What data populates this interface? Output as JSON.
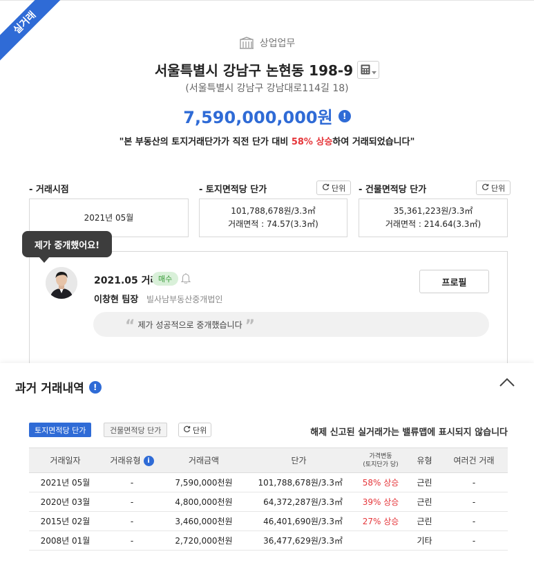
{
  "corner_badge": "실거래",
  "header": {
    "category": "상업업무",
    "address": "서울특별시 강남구 논현동 198-9",
    "road_address": "(서울특별시 강남구 강남대로114길 18)",
    "price": "7,590,000,000원"
  },
  "notice": {
    "prefix": "\"본 부동산의 토지거래단가가 직전 단가 대비",
    "highlight": "58% 상승",
    "suffix": "하여 거래되었습니다\""
  },
  "summary": {
    "date_label": "- 거래시점",
    "date_value": "2021년 05월",
    "land_label": "- 토지면적당 단가",
    "land_price": "101,788,678원/3.3㎡",
    "land_area": "거래면적 : 74.57(3.3㎡)",
    "bldg_label": "- 건물면적당 단가",
    "bldg_price": "35,361,223원/3.3㎡",
    "bldg_area": "거래면적 : 214.64(3.3㎡)",
    "unit_label": "단위"
  },
  "agent": {
    "tooltip": "제가 중개했어요!",
    "deal": "2021.05 거래",
    "badge": "매수",
    "name": "이창현 팀장",
    "agency": "빌사남부동산중개법인",
    "profile_button": "프로필",
    "comment": "제가 성공적으로 중개했습니다"
  },
  "history": {
    "title": "과거 거래내역",
    "tab_land": "토지면적당 단가",
    "tab_bldg": "건물면적당 단가",
    "unit_label": "단위",
    "hint": "해제 신고된 실거래가는 밸류맵에 표시되지 않습니다",
    "columns": {
      "date": "거래일자",
      "type": "거래유형",
      "amount": "거래금액",
      "unit_price": "단가",
      "change1": "가격변동",
      "change2": "(토지단가 당)",
      "kind": "유형",
      "multi": "여러건 거래"
    },
    "rows": [
      {
        "date": "2021년 05월",
        "type": "-",
        "amount": "7,590,000천원",
        "unit_price": "101,788,678원/3.3㎡",
        "change": "58% 상승",
        "kind": "근린",
        "multi": "-"
      },
      {
        "date": "2020년 03월",
        "type": "-",
        "amount": "4,800,000천원",
        "unit_price": "64,372,287원/3.3㎡",
        "change": "39% 상승",
        "kind": "근린",
        "multi": "-"
      },
      {
        "date": "2015년 02월",
        "type": "-",
        "amount": "3,460,000천원",
        "unit_price": "46,401,690원/3.3㎡",
        "change": "27% 상승",
        "kind": "근린",
        "multi": "-"
      },
      {
        "date": "2008년 01월",
        "type": "-",
        "amount": "2,720,000천원",
        "unit_price": "36,477,629원/3.3㎡",
        "change": "",
        "kind": "기타",
        "multi": "-"
      }
    ]
  },
  "colors": {
    "accent": "#2f6bd6",
    "rise": "#e5363a",
    "badge_bg": "#d9f0d9"
  }
}
